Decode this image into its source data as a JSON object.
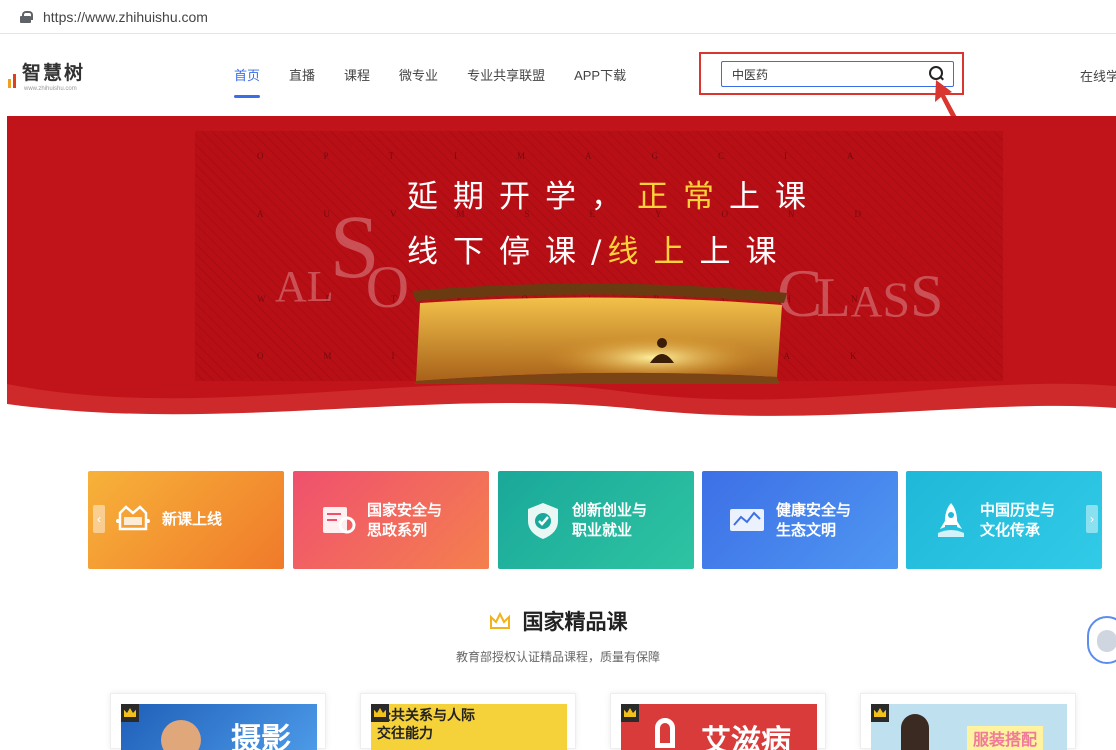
{
  "browser": {
    "url": "https://www.zhihuishu.com"
  },
  "logo": {
    "name": "智慧树",
    "sub": "www.zhihuishu.com"
  },
  "nav": {
    "items": [
      {
        "label": "首页"
      },
      {
        "label": "直播"
      },
      {
        "label": "课程"
      },
      {
        "label": "微专业"
      },
      {
        "label": "专业共享联盟"
      },
      {
        "label": "APP下载"
      }
    ],
    "right_link": "在线学"
  },
  "search": {
    "value": "中医药"
  },
  "hero": {
    "line1_a": "延期开学，",
    "line1_b": "正常",
    "line1_c": "上课",
    "line2_a": "线下停课",
    "line2_sep": "/",
    "line2_b": "线上",
    "line2_c": "上课",
    "bg_word_left": "ALSO",
    "bg_word_right": "CLASS"
  },
  "categories": [
    {
      "line1": "新课上线",
      "line2": "",
      "color_from": "#f7b23a",
      "color_to": "#f07a2a",
      "icon": "calendar-crown-icon"
    },
    {
      "line1": "国家安全与",
      "line2": "思政系列",
      "color_from": "#f0506e",
      "color_to": "#f4804e",
      "icon": "document-search-icon"
    },
    {
      "line1": "创新创业与",
      "line2": "职业就业",
      "color_from": "#1aa89a",
      "color_to": "#2ec4a2",
      "icon": "shield-check-icon"
    },
    {
      "line1": "健康安全与",
      "line2": "生态文明",
      "color_from": "#3d6fe6",
      "color_to": "#4f97f2",
      "icon": "chart-board-icon"
    },
    {
      "line1": "中国历史与",
      "line2": "文化传承",
      "color_from": "#1fb8d8",
      "color_to": "#31cbe8",
      "icon": "rocket-icon"
    }
  ],
  "section": {
    "title": "国家精品课",
    "subtitle": "教育部授权认证精品课程，质量有保障"
  },
  "courses": [
    {
      "thumb_text": "摄影",
      "bg": "#2f6fc4",
      "icon": "crown-badge-icon"
    },
    {
      "thumb_text": "公共关系与人际交往能力",
      "bg": "#f5d13a",
      "icon": "crown-badge-icon"
    },
    {
      "thumb_text": "艾滋病",
      "bg": "#d93a3a",
      "icon": "crown-badge-icon"
    },
    {
      "thumb_text": "服装搭配",
      "bg": "#bfe0ee",
      "icon": "crown-badge-icon"
    }
  ],
  "colors": {
    "brand_blue": "#3a6ee8",
    "hero_red": "#c1141a",
    "highlight": "#d9362f",
    "gold": "#ffd23a"
  }
}
